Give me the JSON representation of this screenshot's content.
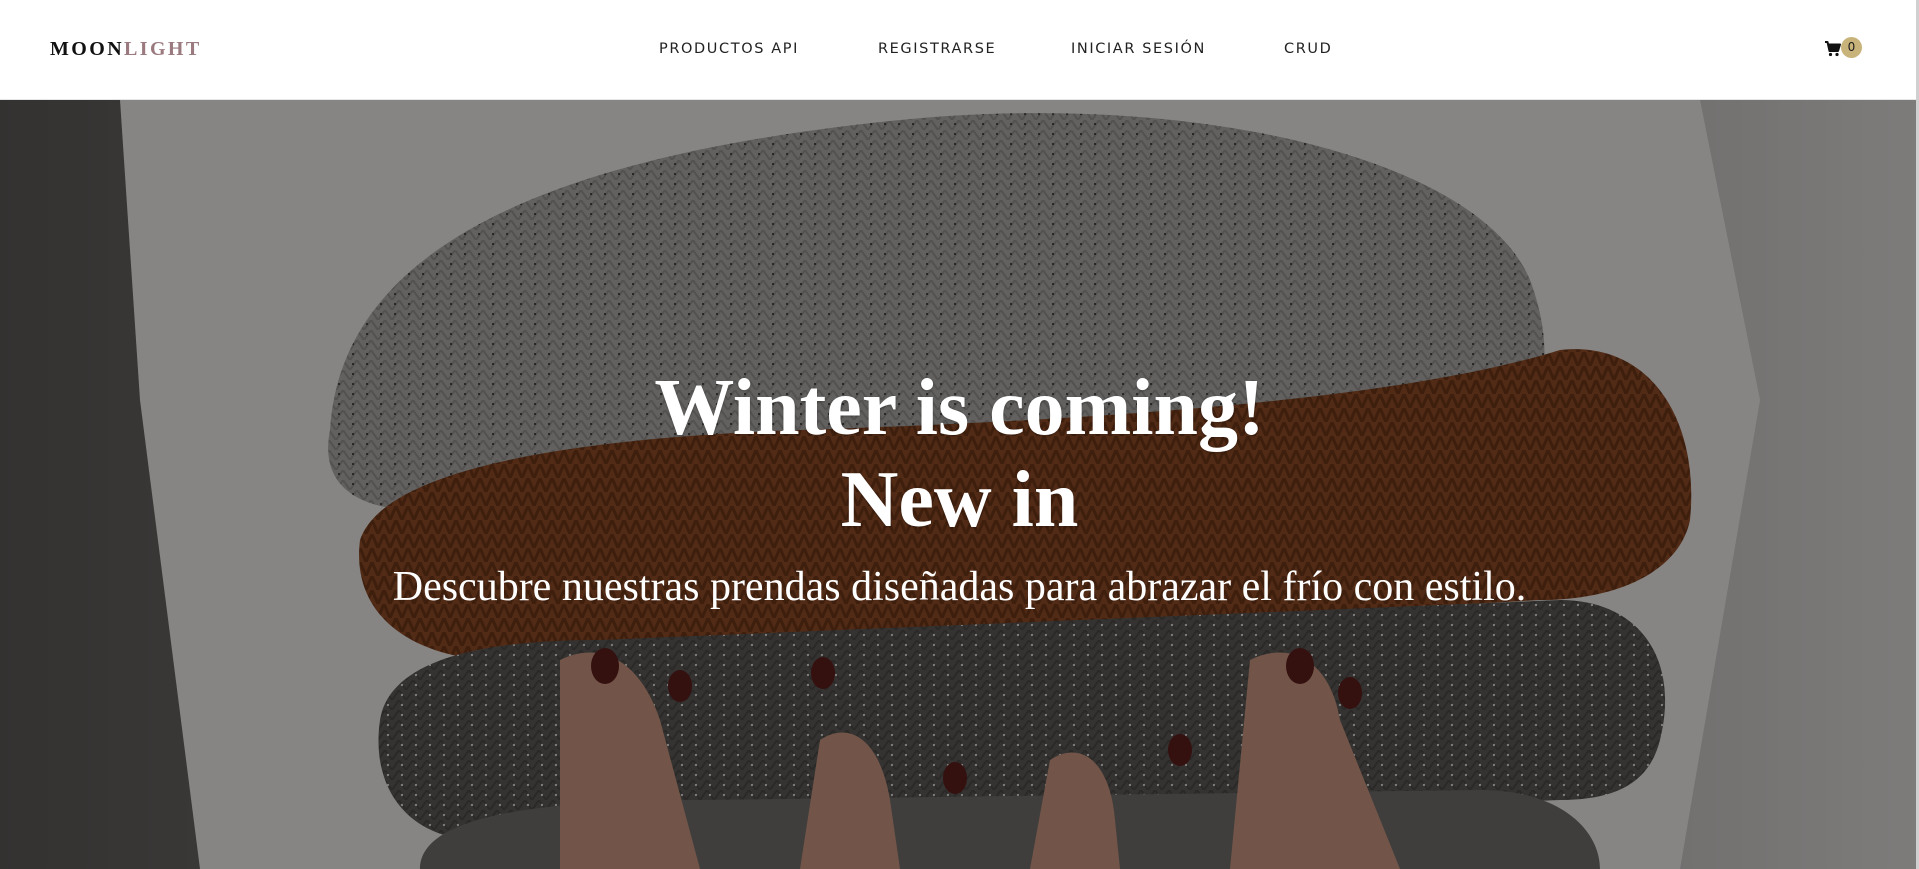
{
  "brand": {
    "part1": "MOON",
    "part2": "LIGHT",
    "accent_color": "#9a7a7e"
  },
  "nav": {
    "items": [
      {
        "label": "PRODUCTOS API"
      },
      {
        "label": "REGISTRARSE"
      },
      {
        "label": "INICIAR SESIÓN"
      },
      {
        "label": "CRUD"
      }
    ]
  },
  "cart": {
    "icon": "shopping-cart-icon",
    "count": "0",
    "badge_color": "#c8b47a"
  },
  "hero": {
    "title_line1": "Winter is coming!",
    "title_line2": "New in",
    "subtitle": "Descubre nuestras prendas diseñadas para abrazar el frío con estilo."
  }
}
